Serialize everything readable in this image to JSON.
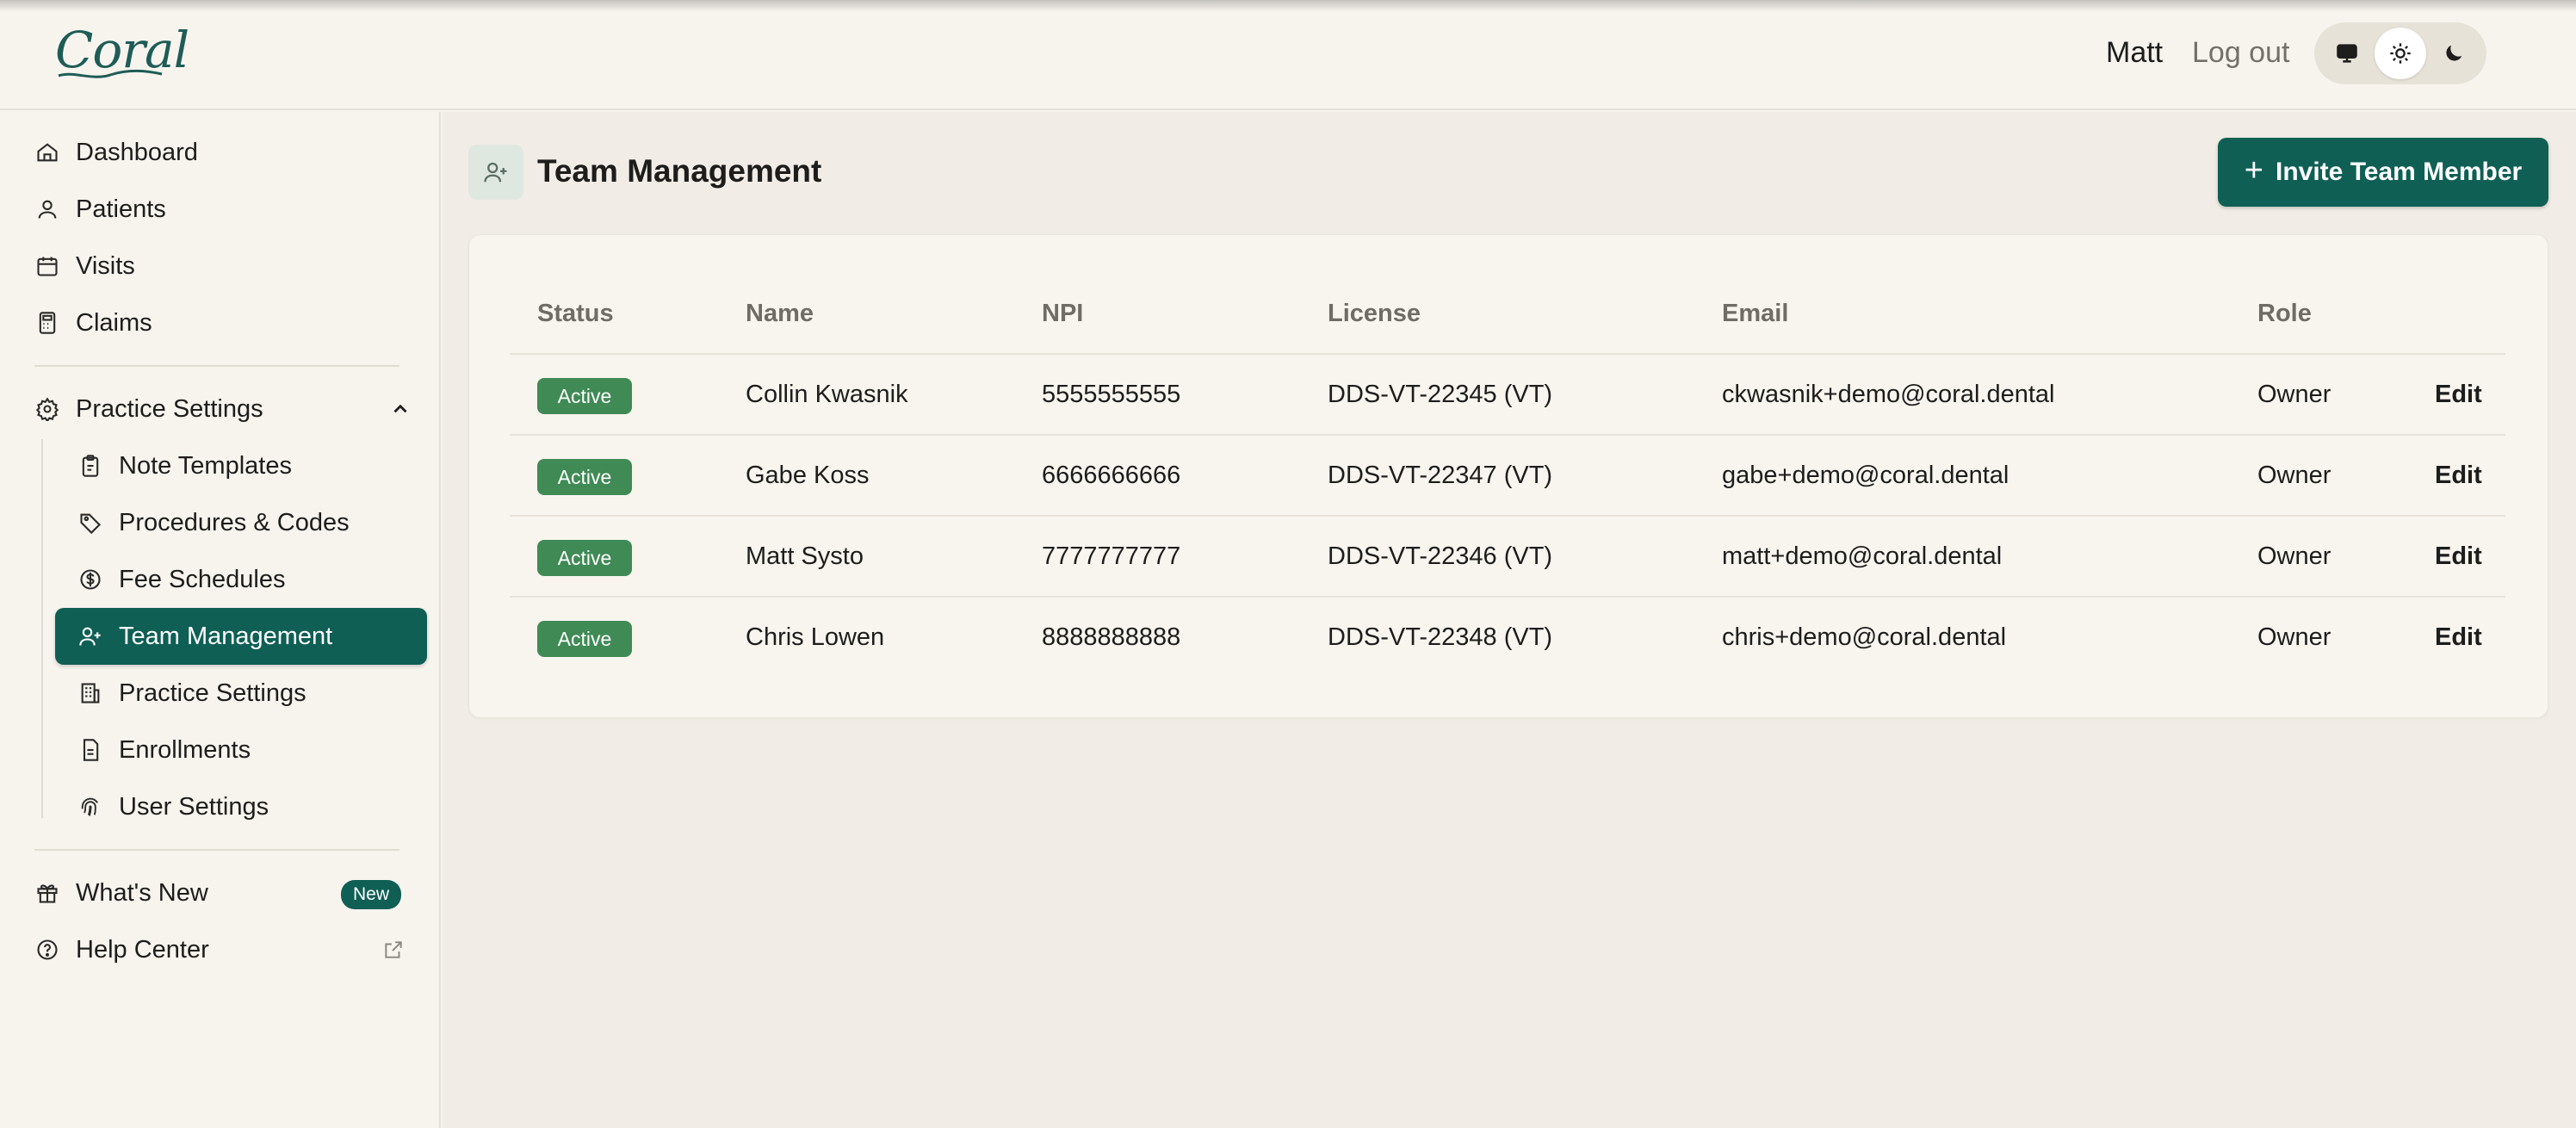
{
  "app": {
    "logo": "Coral"
  },
  "header": {
    "user_name": "Matt",
    "logout_label": "Log out",
    "theme_options": [
      "monitor-icon",
      "sun-icon",
      "moon-icon"
    ],
    "theme_selected": "light"
  },
  "sidebar": {
    "main_items": [
      {
        "label": "Dashboard",
        "icon": "home-icon"
      },
      {
        "label": "Patients",
        "icon": "user-icon"
      },
      {
        "label": "Visits",
        "icon": "calendar-icon"
      },
      {
        "label": "Claims",
        "icon": "calculator-icon"
      }
    ],
    "settings_group": {
      "label": "Practice Settings",
      "icon": "gear-icon",
      "expanded": true
    },
    "settings_items": [
      {
        "label": "Note Templates",
        "icon": "clipboard-icon"
      },
      {
        "label": "Procedures & Codes",
        "icon": "tag-icon"
      },
      {
        "label": "Fee Schedules",
        "icon": "dollar-circle-icon"
      },
      {
        "label": "Team Management",
        "icon": "user-plus-icon",
        "active": true
      },
      {
        "label": "Practice Settings",
        "icon": "building-icon"
      },
      {
        "label": "Enrollments",
        "icon": "document-icon"
      },
      {
        "label": "User Settings",
        "icon": "fingerprint-icon"
      }
    ],
    "footer_items": [
      {
        "label": "What's New",
        "icon": "gift-icon",
        "badge": "New"
      },
      {
        "label": "Help Center",
        "icon": "help-circle-icon",
        "trailing_icon": "external-link-icon"
      }
    ]
  },
  "page": {
    "title": "Team Management",
    "title_icon": "user-plus-icon",
    "invite_button": "Invite Team Member"
  },
  "table": {
    "columns": [
      "Status",
      "Name",
      "NPI",
      "License",
      "Email",
      "Role"
    ],
    "rows": [
      {
        "status": "Active",
        "name": "Collin Kwasnik",
        "npi": "5555555555",
        "license": "DDS-VT-22345 (VT)",
        "email": "ckwasnik+demo@coral.dental",
        "role": "Owner",
        "action": "Edit"
      },
      {
        "status": "Active",
        "name": "Gabe Koss",
        "npi": "6666666666",
        "license": "DDS-VT-22347 (VT)",
        "email": "gabe+demo@coral.dental",
        "role": "Owner",
        "action": "Edit"
      },
      {
        "status": "Active",
        "name": "Matt Systo",
        "npi": "7777777777",
        "license": "DDS-VT-22346 (VT)",
        "email": "matt+demo@coral.dental",
        "role": "Owner",
        "action": "Edit"
      },
      {
        "status": "Active",
        "name": "Chris Lowen",
        "npi": "8888888888",
        "license": "DDS-VT-22348 (VT)",
        "email": "chris+demo@coral.dental",
        "role": "Owner",
        "action": "Edit"
      }
    ]
  },
  "colors": {
    "brand": "#0f5f55",
    "status_active": "#3f8a55",
    "background": "#f7f4ee"
  }
}
